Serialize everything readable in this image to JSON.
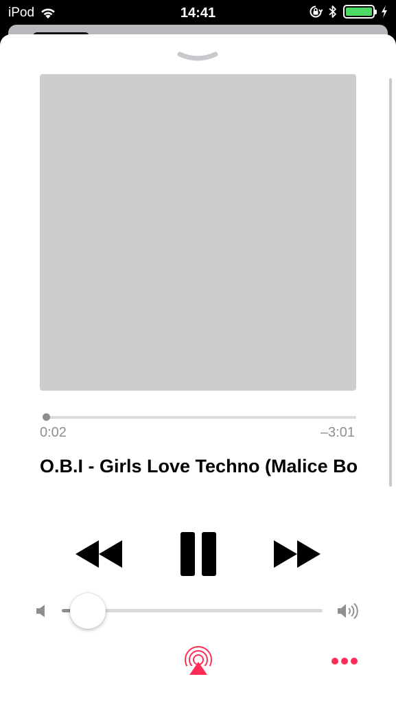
{
  "status_bar": {
    "carrier": "iPod",
    "time": "14:41",
    "battery_level": 1.0,
    "battery_color": "#4cd964",
    "icons": [
      "wifi-icon",
      "orientation-lock-icon",
      "bluetooth-icon",
      "battery-icon",
      "charging-icon"
    ]
  },
  "player": {
    "track_title": "O.B.I - Girls Love Techno (Malice Bo",
    "elapsed": "0:02",
    "remaining": "–3:01",
    "progress": 0.011,
    "volume": 0.1,
    "artwork": "placeholder",
    "controls": [
      "rewind-icon",
      "pause-icon",
      "fast-forward-icon"
    ],
    "accent_color": "#ff2d55"
  }
}
